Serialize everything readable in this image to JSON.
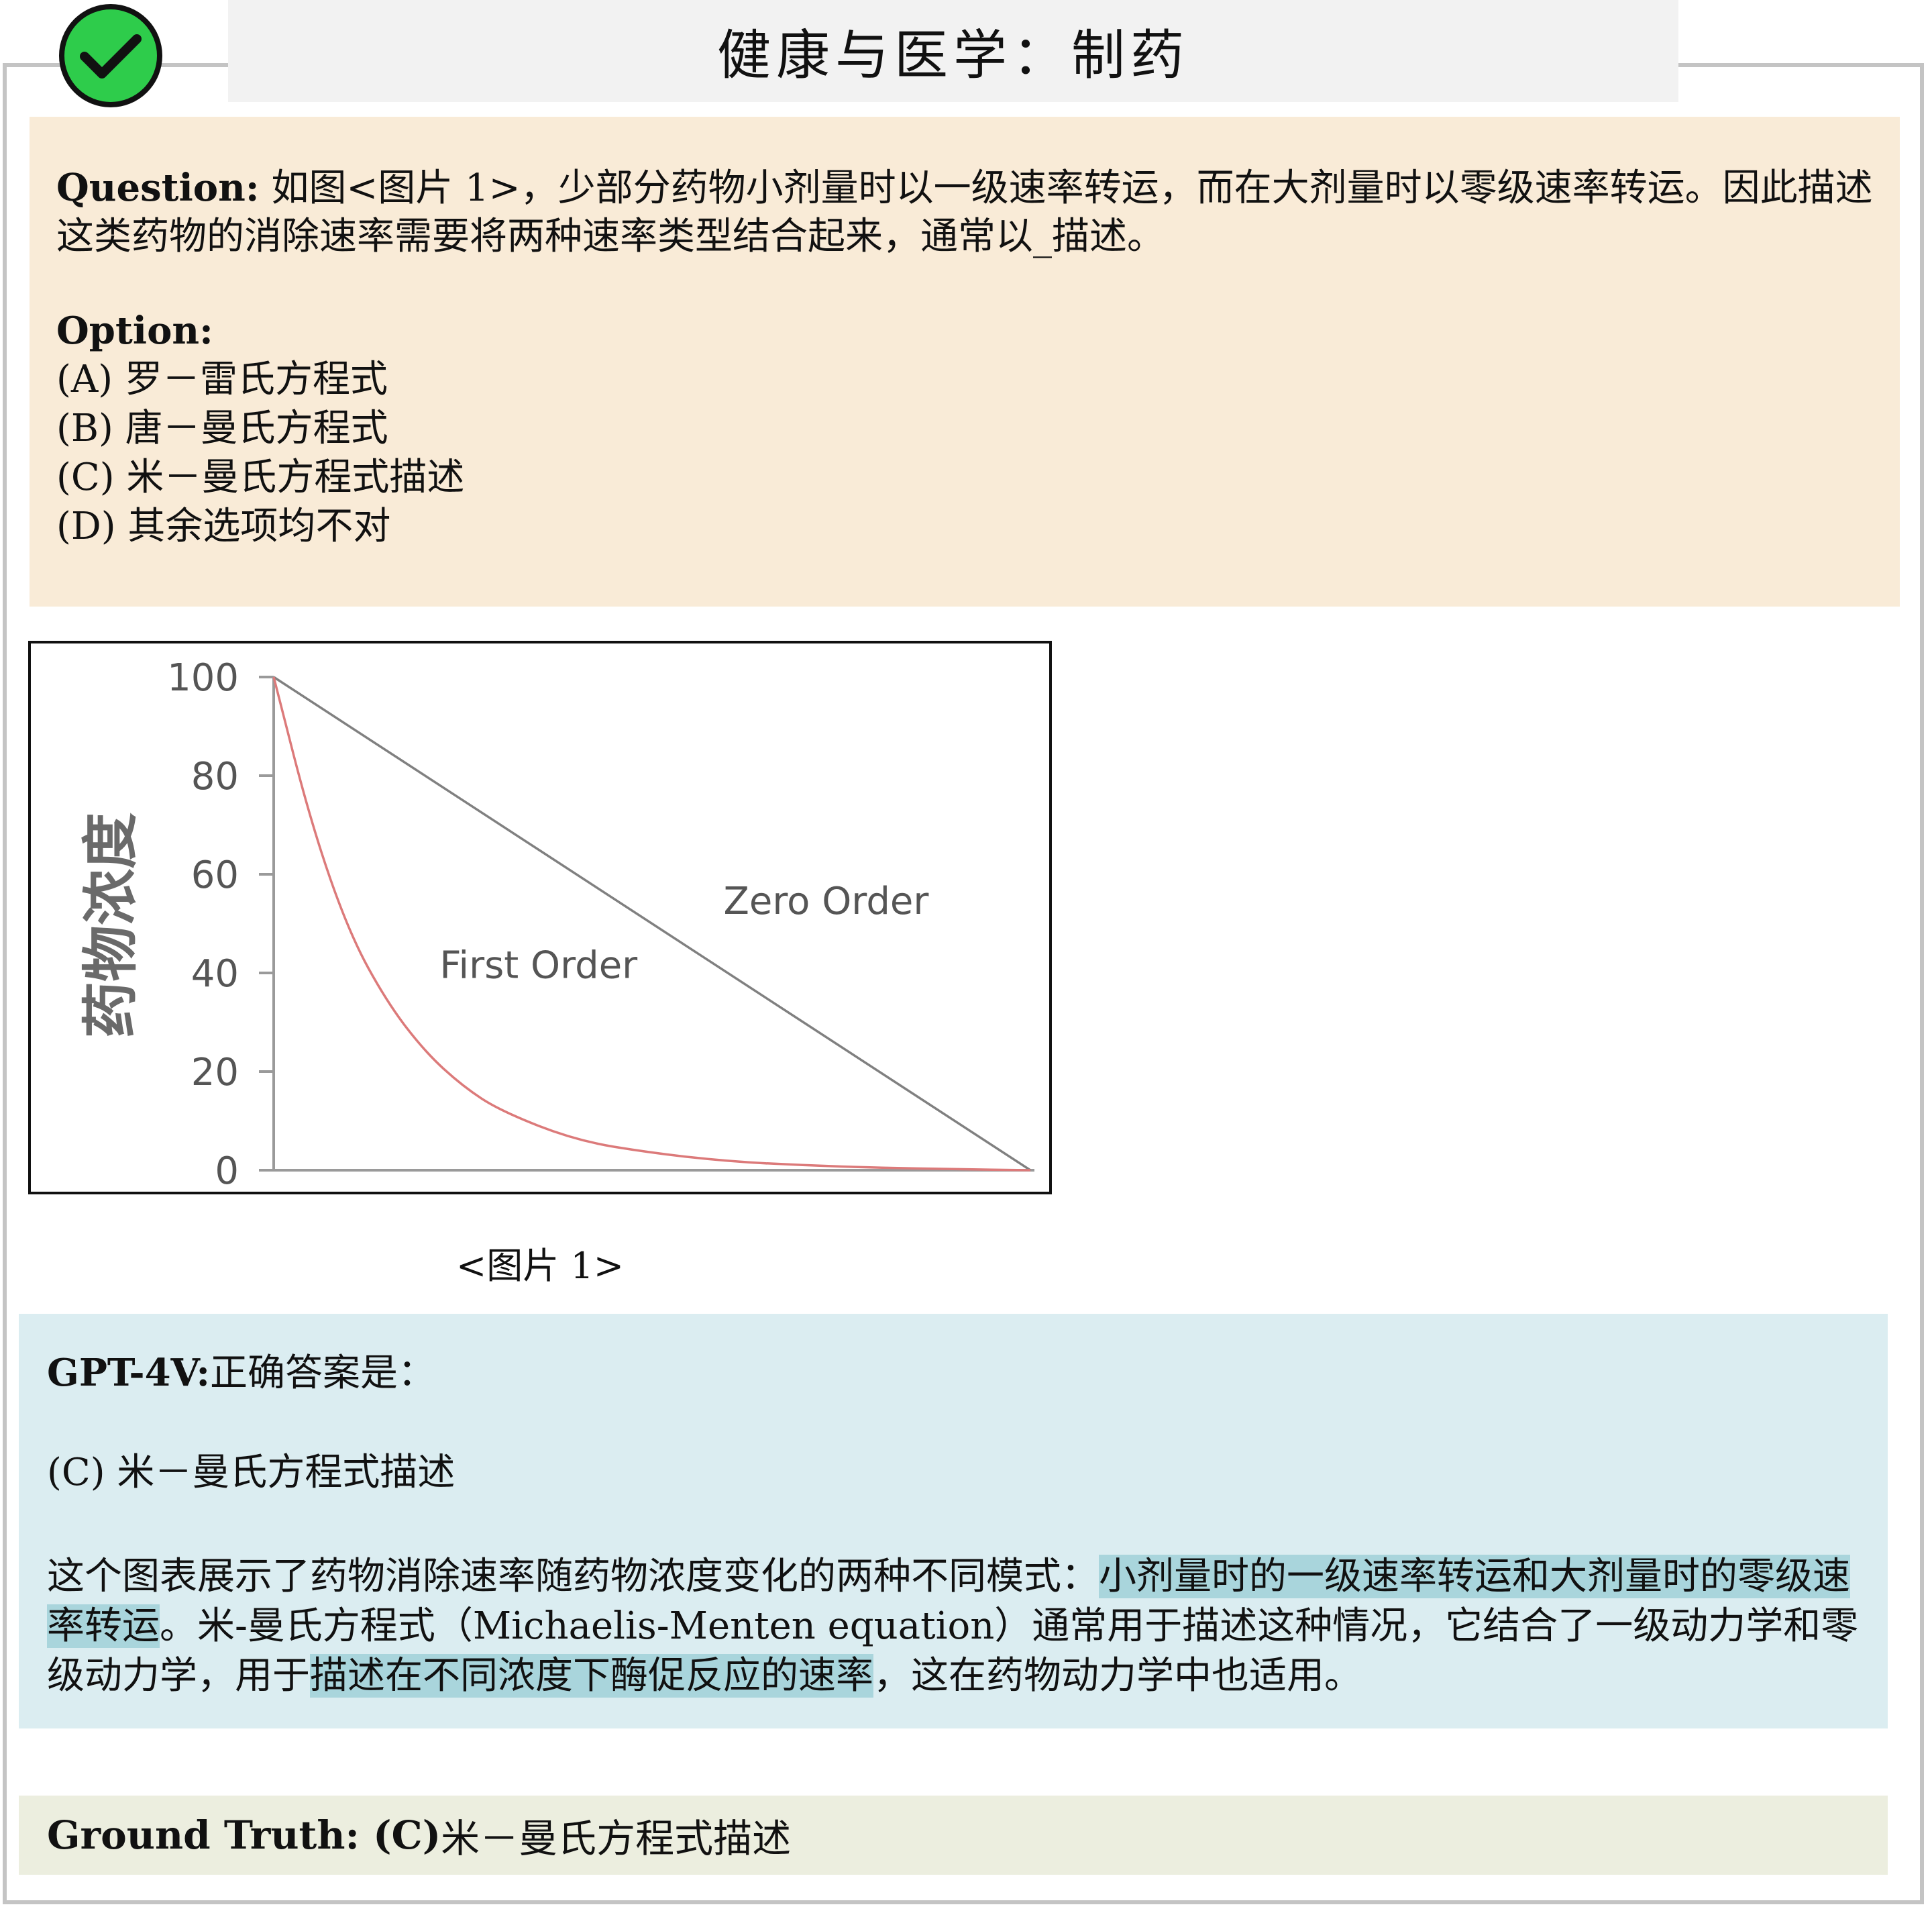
{
  "title": "健康与医学：制药",
  "question": {
    "label": "Question:",
    "text": " 如图<图片 1>，少部分药物小剂量时以一级速率转运，而在大剂量时以零级速率转运。因此描述这类药物的消除速率需要将两种速率类型结合起来，通常以_描述。",
    "option_label": "Option:",
    "options": [
      "(A)  罗－雷氏方程式",
      "(B) 唐－曼氏方程式",
      "(C) 米－曼氏方程式描述",
      "(D) 其余选项均不对"
    ]
  },
  "figure": {
    "caption": "<图片 1>",
    "chart_data": {
      "type": "line",
      "ylabel": "药物浓度",
      "xlabel": "",
      "ylim": [
        0,
        100
      ],
      "yticks": [
        "0",
        "20",
        "40",
        "60",
        "80",
        "100"
      ],
      "xlim": [
        0,
        1
      ],
      "grid": false,
      "series": [
        {
          "name": "Zero Order",
          "color": "#808080",
          "x": [
            0,
            1
          ],
          "y": [
            100,
            0
          ]
        },
        {
          "name": "First Order",
          "color": "#dc7a7a",
          "x": [
            0,
            0.05,
            0.1,
            0.15,
            0.2,
            0.25,
            0.3,
            0.4,
            0.5,
            0.6,
            0.7,
            0.8,
            0.9,
            1.0
          ],
          "y": [
            100,
            70,
            48,
            34,
            24,
            17,
            12,
            6,
            3.5,
            1.8,
            1,
            0.5,
            0.2,
            0
          ]
        }
      ],
      "annotations": [
        {
          "text": "Zero Order",
          "x": 0.73,
          "y": 52
        },
        {
          "text": "First Order",
          "x": 0.35,
          "y": 39
        }
      ]
    }
  },
  "answer": {
    "model_label": "GPT-4V:",
    "intro": "正确答案是：",
    "choice": "(C) 米－曼氏方程式描述",
    "expl_1": "这个图表展示了药物消除速率随药物浓度变化的两种不同模式：",
    "expl_hl_1": "小剂量时的一级速率转运和大剂量时的零级速率转运",
    "expl_2": "。米-曼氏方程式（Michaelis-Menten equation）通常用于描述这种情况，它结合了一级动力学和零级动力学，用于",
    "expl_hl_2": "描述在不同浓度下酶促反应的速率",
    "expl_3": "，这在药物动力学中也适用。"
  },
  "ground_truth": {
    "label": "Ground Truth: (C)",
    "value": "米－曼氏方程式描述"
  },
  "colors": {
    "check_green": "#2ecc4b",
    "question_bg": "#f9ebd7",
    "answer_bg": "#dbedf1",
    "highlight": "#a9d5dc",
    "truth_bg": "#eceedf"
  },
  "icons": [
    "check-circle-icon"
  ]
}
